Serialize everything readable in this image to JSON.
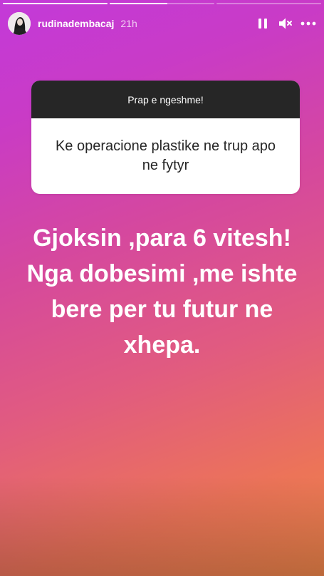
{
  "progress": {
    "segments": 3,
    "completed": 1,
    "current_fraction": 0.55
  },
  "header": {
    "username": "rudinadembacaj",
    "time": "21h",
    "pause_icon": "pause-icon",
    "mute_icon": "muted-speaker-icon",
    "more_icon": "more-dots-icon"
  },
  "question": {
    "prompt": "Prap e ngeshme!",
    "text": "Ke operacione plastike ne trup apo ne fytyr"
  },
  "answer": {
    "text": "Gjoksin ,para 6 vitesh! Nga dobesimi ,me ishte bere per tu futur ne xhepa."
  },
  "colors": {
    "gradient_top": "#c33ad9",
    "gradient_bottom": "#f0864a",
    "card_header": "#262626",
    "card_body": "#ffffff"
  }
}
